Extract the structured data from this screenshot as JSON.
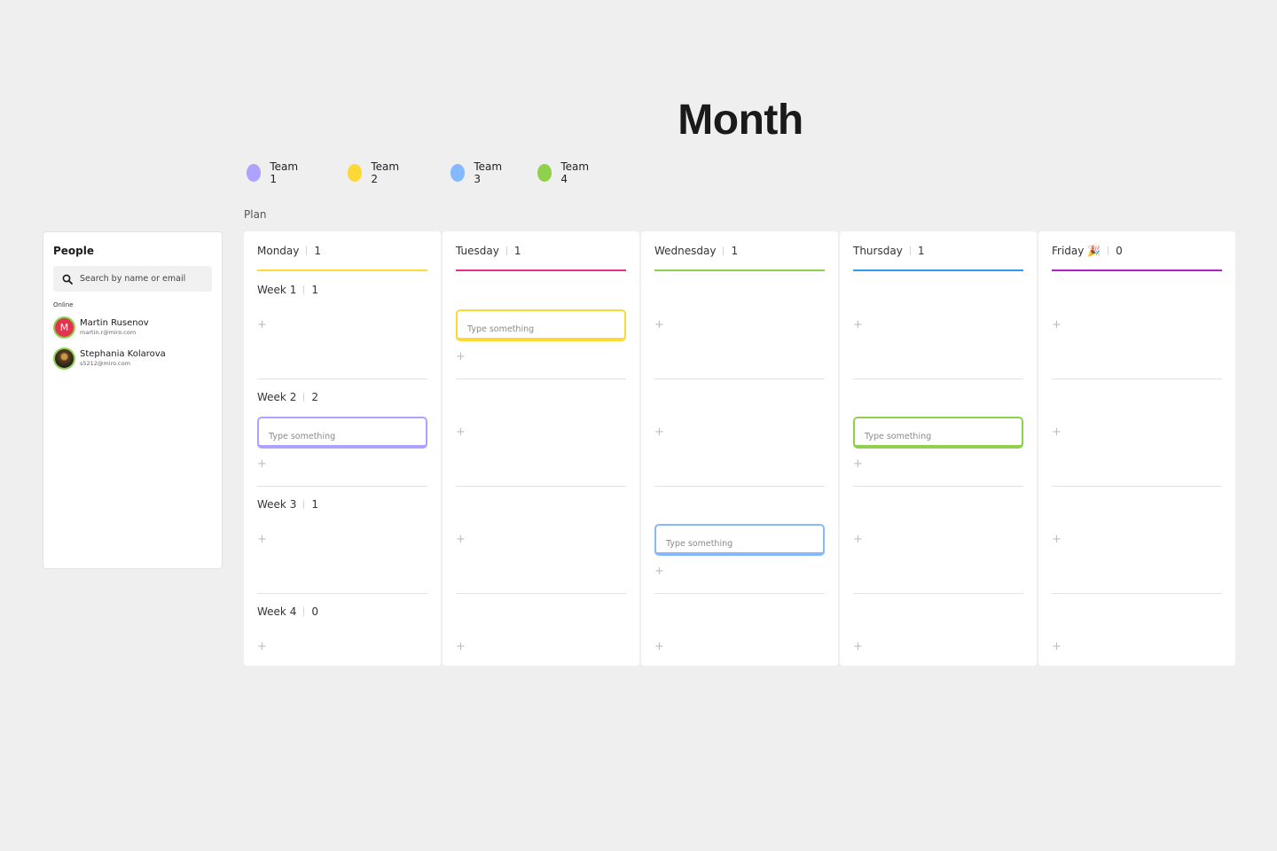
{
  "title": "Month",
  "legend": [
    {
      "label": "Team 1",
      "color": "#ada2ff"
    },
    {
      "label": "Team 2",
      "color": "#fdd836"
    },
    {
      "label": "Team 3",
      "color": "#85b8ff"
    },
    {
      "label": "Team 4",
      "color": "#8fd14f"
    }
  ],
  "plan_label": "Plan",
  "people": {
    "title": "People",
    "search_placeholder": "Search by name or email",
    "online_label": "Online",
    "members": [
      {
        "name": "Martin Rusenov",
        "email": "martin.r@miro.com",
        "initial": "M"
      },
      {
        "name": "Stephania Kolarova",
        "email": "s5212@miro.com",
        "initial": ""
      }
    ]
  },
  "days": [
    {
      "name": "Monday",
      "count": "1",
      "color": "#fdd836"
    },
    {
      "name": "Tuesday",
      "count": "1",
      "color": "#e6308a"
    },
    {
      "name": "Wednesday",
      "count": "1",
      "color": "#8fd14f"
    },
    {
      "name": "Thursday",
      "count": "1",
      "color": "#2d9bf0"
    },
    {
      "name": "Friday 🎉",
      "count": "0",
      "color": "#b520c9"
    }
  ],
  "weeks": [
    {
      "name": "Week 1",
      "count": "1"
    },
    {
      "name": "Week 2",
      "count": "2"
    },
    {
      "name": "Week 3",
      "count": "1"
    },
    {
      "name": "Week 4",
      "count": "0"
    }
  ],
  "cards": {
    "placeholder": "Type something",
    "tuesday_week1": {
      "color": "#fdd836"
    },
    "monday_week2": {
      "color": "#ada2ff"
    },
    "thursday_week2": {
      "color": "#8fd14f"
    },
    "wednesday_week3": {
      "color": "#85b8ff"
    }
  },
  "add_icon": "+"
}
